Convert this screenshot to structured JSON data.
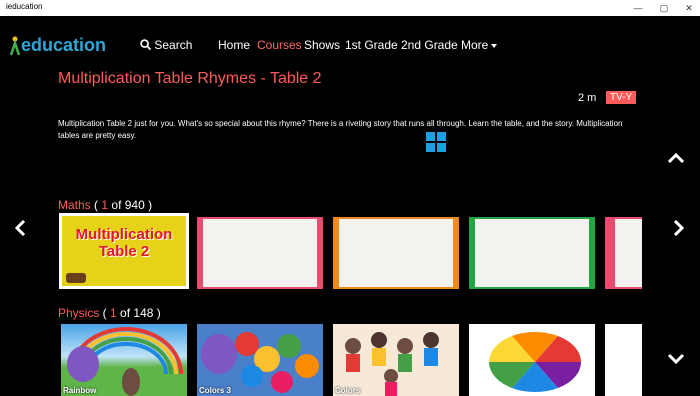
{
  "window": {
    "title": "ieducation",
    "minimize": "—",
    "restore": "▢",
    "close": "✕"
  },
  "nav": {
    "logo_text": "education",
    "search_label": "Search",
    "items": [
      "Home",
      "Courses",
      "Shows",
      "1st Grade",
      "2nd Grade",
      "More"
    ],
    "active": "Courses"
  },
  "video": {
    "title": "Multiplication Table Rhymes - Table 2",
    "duration": "2 m",
    "rating": "TV-Y",
    "description": "Multiplication Table 2 just for you. What's so special about this rhyme? There is a riveting story that runs all through. Learn the table, and the story. Multiplication tables are pretty easy."
  },
  "sections": [
    {
      "name": "Maths",
      "current": "1",
      "of_label": "of 940",
      "thumb_title": "Multiplication Table 2"
    },
    {
      "name": "Physics",
      "current": "1",
      "of_label": "of 148",
      "thumb_labels": [
        "Rainbow",
        "Colors 3",
        "Colors"
      ]
    }
  ],
  "colors": {
    "accent": "#ff5b5b",
    "logo": "#2fa6d6"
  }
}
